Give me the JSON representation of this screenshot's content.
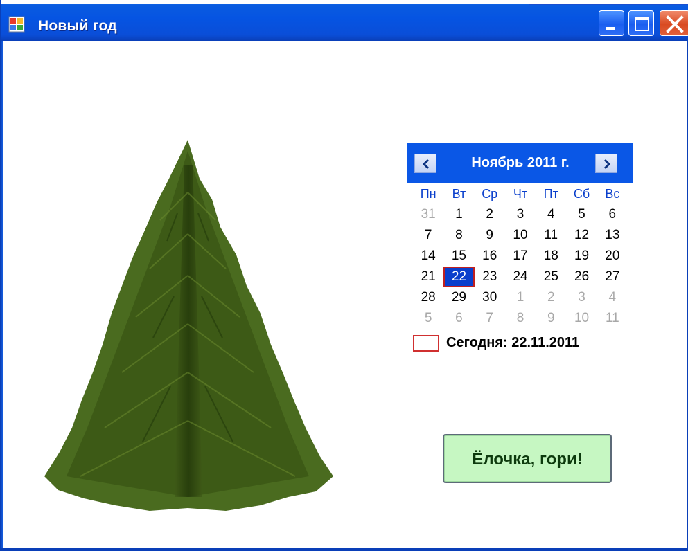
{
  "window": {
    "title": "Новый год"
  },
  "calendar": {
    "month_label": "Ноябрь 2011 г.",
    "weekdays": [
      "Пн",
      "Вт",
      "Ср",
      "Чт",
      "Пт",
      "Сб",
      "Вс"
    ],
    "weeks": [
      [
        {
          "d": "31",
          "other": true
        },
        {
          "d": "1"
        },
        {
          "d": "2"
        },
        {
          "d": "3"
        },
        {
          "d": "4"
        },
        {
          "d": "5"
        },
        {
          "d": "6"
        }
      ],
      [
        {
          "d": "7"
        },
        {
          "d": "8"
        },
        {
          "d": "9"
        },
        {
          "d": "10"
        },
        {
          "d": "11"
        },
        {
          "d": "12"
        },
        {
          "d": "13"
        }
      ],
      [
        {
          "d": "14"
        },
        {
          "d": "15"
        },
        {
          "d": "16"
        },
        {
          "d": "17"
        },
        {
          "d": "18"
        },
        {
          "d": "19"
        },
        {
          "d": "20"
        }
      ],
      [
        {
          "d": "21"
        },
        {
          "d": "22",
          "selected": true
        },
        {
          "d": "23"
        },
        {
          "d": "24"
        },
        {
          "d": "25"
        },
        {
          "d": "26"
        },
        {
          "d": "27"
        }
      ],
      [
        {
          "d": "28"
        },
        {
          "d": "29"
        },
        {
          "d": "30"
        },
        {
          "d": "1",
          "other": true
        },
        {
          "d": "2",
          "other": true
        },
        {
          "d": "3",
          "other": true
        },
        {
          "d": "4",
          "other": true
        }
      ],
      [
        {
          "d": "5",
          "other": true
        },
        {
          "d": "6",
          "other": true
        },
        {
          "d": "7",
          "other": true
        },
        {
          "d": "8",
          "other": true
        },
        {
          "d": "9",
          "other": true
        },
        {
          "d": "10",
          "other": true
        },
        {
          "d": "11",
          "other": true
        }
      ]
    ],
    "today_label": "Сегодня: 22.11.2011",
    "prev_icon": "chevron-left-icon",
    "next_icon": "chevron-right-icon"
  },
  "button": {
    "label": "Ёлочка, гори!",
    "background": "#c6f7c2"
  },
  "colors": {
    "titlebar": "#0654e2",
    "calendar_header": "#0a57e6",
    "weekday_text": "#0a3fcc",
    "selected_day": "#0a3fcc",
    "today_marker": "#d03030"
  }
}
